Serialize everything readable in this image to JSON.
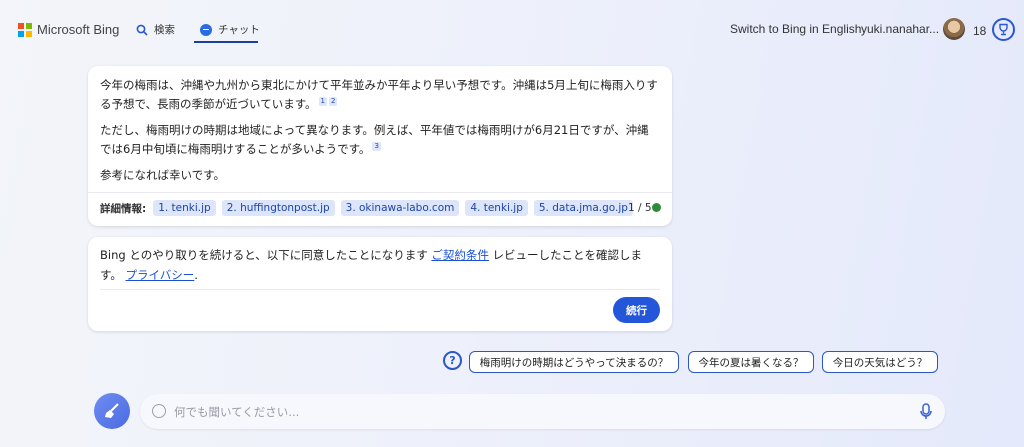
{
  "header": {
    "logo_text": "Microsoft Bing",
    "nav": [
      {
        "label": "検索",
        "icon": "search-icon"
      },
      {
        "label": "チャット",
        "icon": "chat-icon",
        "active": true
      }
    ],
    "switch_link": "Switch to Bing in English",
    "username": "yuki.nanahar...",
    "points": "18",
    "brand_colors": {
      "red": "#f25022",
      "green": "#7fba00",
      "blue": "#00a4ef",
      "yellow": "#ffb900"
    }
  },
  "answer": {
    "para1": "今年の梅雨は、沖縄や九州から東北にかけて平年並みか平年より早い予想です。沖縄は5月上旬に梅雨入りする予想で、長雨の季節が近づいています。",
    "para1_cites": [
      "1",
      "2"
    ],
    "para2": "ただし、梅雨明けの時期は地域によって異なります。例えば、平年値では梅雨明けが6月21日ですが、沖縄では6月中旬頃に梅雨明けすることが多いようです。",
    "para2_cites": [
      "3"
    ],
    "para3": "参考になれば幸いです。",
    "refs_label": "詳細情報:",
    "refs": [
      "1. tenki.jp",
      "2. huffingtonpost.jp",
      "3. okinawa-labo.com",
      "4. tenki.jp",
      "5. data.jma.go.jp"
    ],
    "page_count": "1 / 5"
  },
  "consent": {
    "text_before": "Bing とのやり取りを続けると、以下に同意したことになります ",
    "terms_link": "ご契約条件",
    "text_middle": " レビューしたことを確認します。 ",
    "privacy_link": "プライバシー",
    "text_after": ".",
    "continue_label": "続行"
  },
  "suggestions": [
    "梅雨明けの時期はどうやって決まるの？",
    "今年の夏は暑くなる？",
    "今日の天気はどう？"
  ],
  "input": {
    "placeholder": "何でも聞いてください..."
  },
  "colors": {
    "accent": "#2356d8",
    "status_green": "#2e8b3a"
  }
}
